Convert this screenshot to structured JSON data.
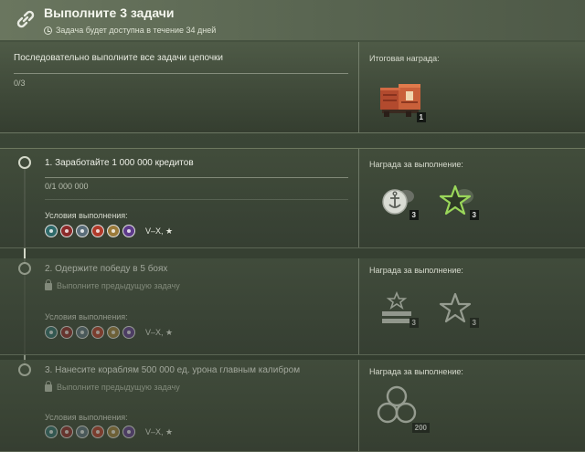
{
  "header": {
    "title": "Выполните 3 задачи",
    "subtitle": "Задача будет доступна в течение 34 дней",
    "icon": "link-icon"
  },
  "summary": {
    "title": "Последовательно выполните все задачи цепочки",
    "progress_text": "0/3",
    "progress": 0,
    "reward_label": "Итоговая награда:",
    "reward_count": "1",
    "reward_icon": "crate-icon"
  },
  "tasks": [
    {
      "title": "1. Заработайте 1 000 000 кредитов",
      "progress_text": "0/1 000 000",
      "progress": 0,
      "conditions_label": "Условия выполнения:",
      "tier": "V–X, ★",
      "reward_label": "Награда за выполнение:",
      "rewards": [
        {
          "icon": "anchor-coin-icon",
          "count": "3"
        },
        {
          "icon": "star-icon",
          "count": "3"
        }
      ],
      "locked": false
    },
    {
      "title": "2. Одержите победу в 5 боях",
      "lock_text": "Выполните предыдущую задачу",
      "conditions_label": "Условия выполнения:",
      "tier": "V–X, ★",
      "reward_label": "Награда за выполнение:",
      "rewards": [
        {
          "icon": "rank-stripes-icon",
          "count": "3"
        },
        {
          "icon": "star-outline-icon",
          "count": "3"
        }
      ],
      "locked": true
    },
    {
      "title": "3. Нанесите кораблям 500 000 ед. урона главным калибром",
      "lock_text": "Выполните предыдущую задачу",
      "conditions_label": "Условия выполнения:",
      "tier": "V–X, ★",
      "reward_label": "Награда за выполнение:",
      "rewards": [
        {
          "icon": "clover-icon",
          "count": "200"
        }
      ],
      "locked": true
    }
  ],
  "colors": {
    "accent_green": "#9ad65a",
    "background": "#353f31"
  }
}
